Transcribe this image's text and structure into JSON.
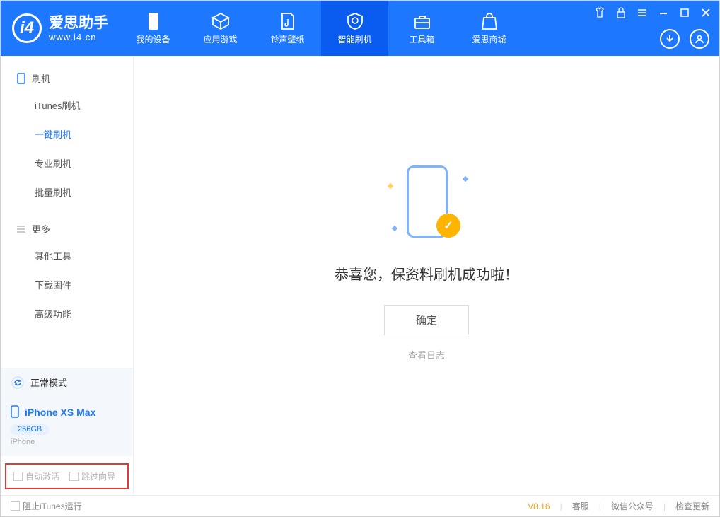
{
  "app": {
    "name": "爱思助手",
    "domain": "www.i4.cn"
  },
  "nav": {
    "items": [
      {
        "label": "我的设备"
      },
      {
        "label": "应用游戏"
      },
      {
        "label": "铃声壁纸"
      },
      {
        "label": "智能刷机"
      },
      {
        "label": "工具箱"
      },
      {
        "label": "爱思商城"
      }
    ]
  },
  "sidebar": {
    "group1": {
      "title": "刷机",
      "items": [
        "iTunes刷机",
        "一键刷机",
        "专业刷机",
        "批量刷机"
      ]
    },
    "group2": {
      "title": "更多",
      "items": [
        "其他工具",
        "下载固件",
        "高级功能"
      ]
    },
    "mode": "正常模式",
    "device": {
      "name": "iPhone XS Max",
      "badge": "256GB",
      "sub": "iPhone"
    },
    "opts": {
      "opt1": "自动激活",
      "opt2": "跳过向导"
    }
  },
  "main": {
    "message": "恭喜您，保资料刷机成功啦！",
    "ok": "确定",
    "loglink": "查看日志"
  },
  "footer": {
    "block_itunes": "阻止iTunes运行",
    "version": "V8.16",
    "links": [
      "客服",
      "微信公众号",
      "检查更新"
    ]
  }
}
